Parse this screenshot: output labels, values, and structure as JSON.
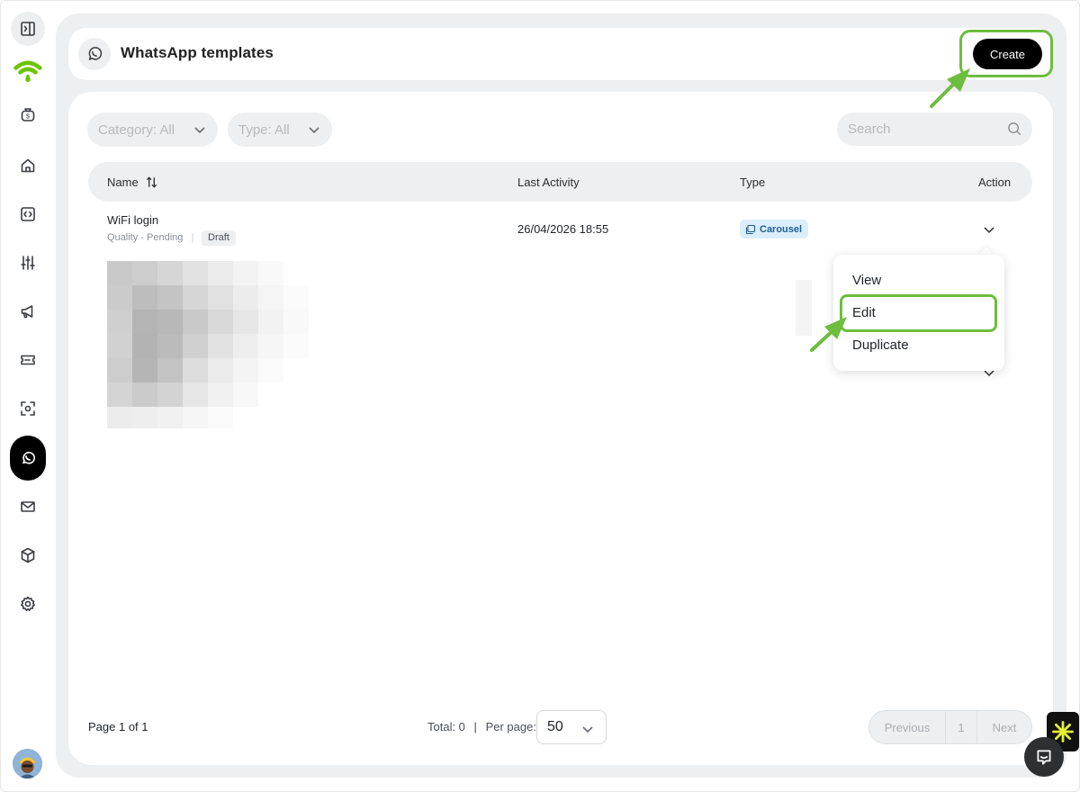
{
  "header": {
    "title": "WhatsApp templates",
    "create_label": "Create"
  },
  "filters": {
    "category": "Category: All",
    "type": "Type: All",
    "search_placeholder": "Search"
  },
  "table": {
    "columns": {
      "name": "Name",
      "last_activity": "Last Activity",
      "type": "Type",
      "action": "Action"
    },
    "rows": [
      {
        "name": "WiFi login",
        "quality": "Quality - Pending",
        "status": "Draft",
        "last_activity": "26/04/2026 18:55",
        "type": "Carousel"
      }
    ]
  },
  "action_menu": {
    "items": [
      "View",
      "Edit",
      "Duplicate"
    ]
  },
  "footer": {
    "page_info": "Page 1 of 1",
    "total": "Total: 0",
    "per_page_label": "Per page:",
    "per_page_value": "50",
    "previous_label": "Previous",
    "current_page": "1",
    "next_label": "Next"
  },
  "sidebar": {
    "icons": [
      "sidebar-toggle-icon",
      "wifi-icon",
      "money-bag-icon",
      "home-icon",
      "code-icon",
      "sliders-icon",
      "megaphone-icon",
      "ticket-icon",
      "scan-icon",
      "whatsapp-icon",
      "mail-icon",
      "cube-icon",
      "settings-icon"
    ]
  },
  "colors": {
    "accent": "#6dbd3e",
    "wifi_green": "#6dc400",
    "primary_button": "#000000",
    "carousel_badge_bg": "#dbeefb",
    "carousel_badge_text": "#1f5f95"
  }
}
